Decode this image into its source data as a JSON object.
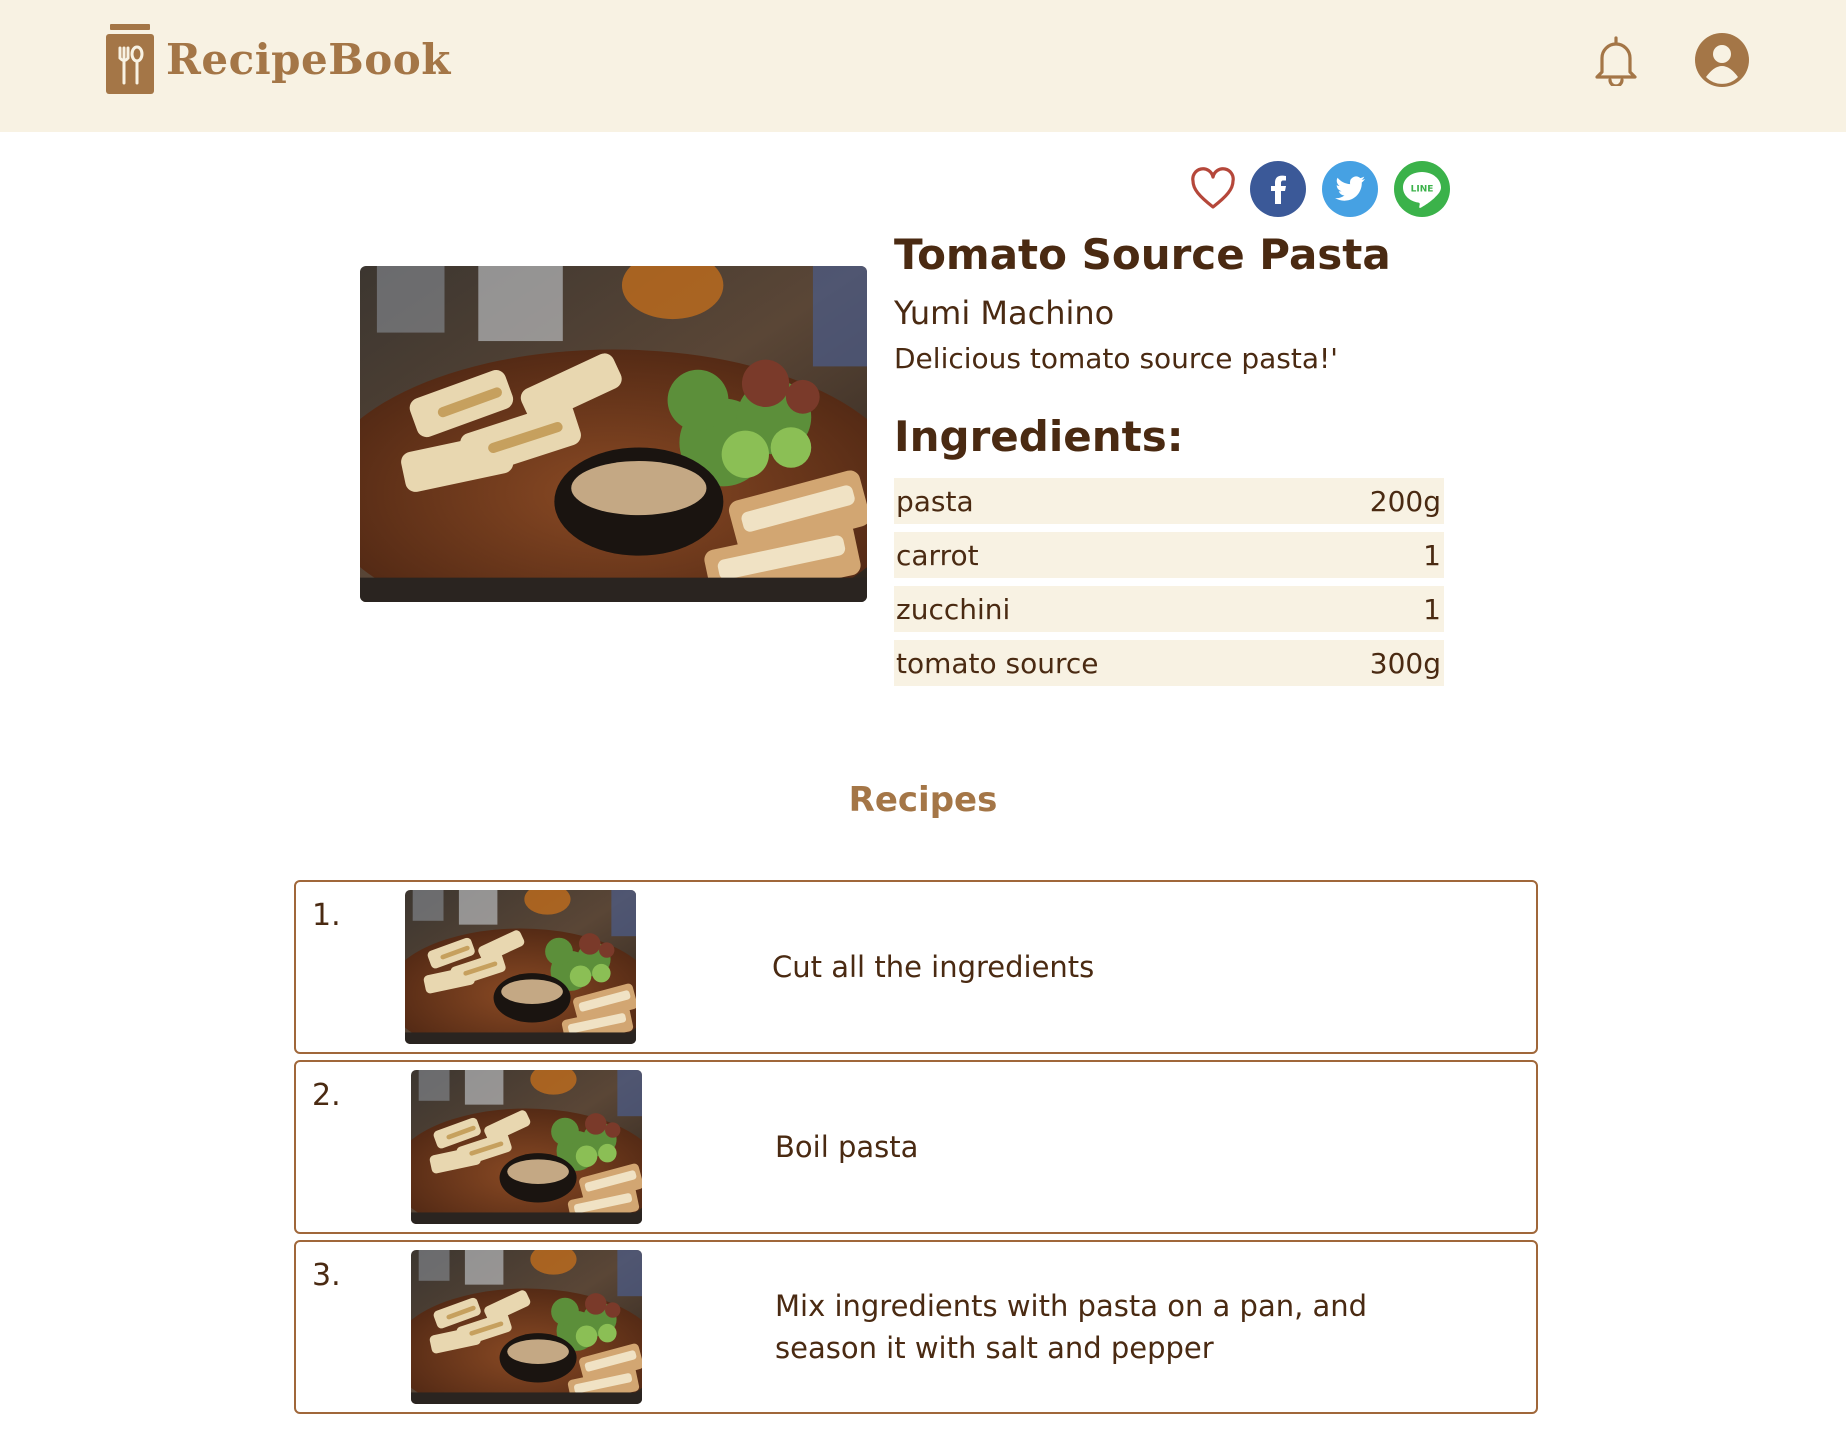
{
  "header": {
    "app_name": "RecipeBook",
    "logo_icon": "utensils-jar-icon",
    "notification_icon": "bell-icon",
    "profile_icon": "user-circle-icon"
  },
  "share": {
    "favorite_icon": "heart-icon",
    "facebook_icon": "facebook-icon",
    "twitter_icon": "twitter-icon",
    "line_icon": "line-icon",
    "line_label": "LINE"
  },
  "recipe": {
    "title": "Tomato Source Pasta",
    "author": "Yumi Machino",
    "description": "Delicious tomato source pasta!'",
    "ingredients_heading": "Ingredients:",
    "ingredients": [
      {
        "name": "pasta",
        "amount": "200g"
      },
      {
        "name": "carrot",
        "amount": "1"
      },
      {
        "name": "zucchini",
        "amount": "1"
      },
      {
        "name": "tomato source",
        "amount": "300g"
      }
    ]
  },
  "recipes_section": {
    "heading": "Recipes",
    "steps": [
      {
        "number": "1.",
        "text": "Cut all the ingredients"
      },
      {
        "number": "2.",
        "text": "Boil pasta"
      },
      {
        "number": "3.",
        "text": "Mix ingredients with pasta on a pan, and season it with salt and pepper"
      }
    ]
  },
  "colors": {
    "header_bg": "#f8f2e3",
    "brand": "#a47647",
    "text": "#4a2a12",
    "border": "#a0673a",
    "heart": "#b5473a",
    "facebook": "#3b5998",
    "twitter": "#46a1e3",
    "line": "#3bb24a"
  }
}
